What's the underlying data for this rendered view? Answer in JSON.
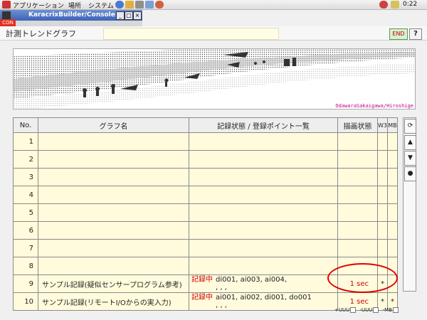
{
  "desktop": {
    "menus": [
      "アプリケーション",
      "場所",
      "システム"
    ],
    "clock": "0:22"
  },
  "window": {
    "title": "KaracrixBuilder/Console",
    "con_tab": "CON"
  },
  "header": {
    "title": "計測トレンドグラフ",
    "end_label": "END",
    "help_label": "?"
  },
  "banner": {
    "caption": "OdawaraSakaigawa/Hiroshige"
  },
  "table": {
    "headers": {
      "no": "No.",
      "name": "グラフ名",
      "points": "記録状態 / 登録ポイント一覧",
      "draw": "描画状態",
      "w3": "W3",
      "mb": "MB"
    },
    "rows": [
      {
        "no": "1",
        "name": "",
        "rec": "",
        "points": "",
        "draw": "",
        "w3": "",
        "mb": ""
      },
      {
        "no": "2",
        "name": "",
        "rec": "",
        "points": "",
        "draw": "",
        "w3": "",
        "mb": ""
      },
      {
        "no": "3",
        "name": "",
        "rec": "",
        "points": "",
        "draw": "",
        "w3": "",
        "mb": ""
      },
      {
        "no": "4",
        "name": "",
        "rec": "",
        "points": "",
        "draw": "",
        "w3": "",
        "mb": ""
      },
      {
        "no": "5",
        "name": "",
        "rec": "",
        "points": "",
        "draw": "",
        "w3": "",
        "mb": ""
      },
      {
        "no": "6",
        "name": "",
        "rec": "",
        "points": "",
        "draw": "",
        "w3": "",
        "mb": ""
      },
      {
        "no": "7",
        "name": "",
        "rec": "",
        "points": "",
        "draw": "",
        "w3": "",
        "mb": ""
      },
      {
        "no": "8",
        "name": "",
        "rec": "",
        "points": "",
        "draw": "",
        "w3": "",
        "mb": ""
      },
      {
        "no": "9",
        "name": "サンプル記録(疑似センサープログラム参考)",
        "rec": "記録中",
        "points": "di001, ai003, ai004,",
        "points2": ", , ,",
        "draw": "1 sec",
        "w3": "*",
        "mb": ""
      },
      {
        "no": "10",
        "name": "サンプル記録(リモートI/Oからの実入力)",
        "rec": "記録中",
        "points": "ai001, ai002, di001, do001",
        "points2": ", , ,",
        "draw": "1 sec",
        "w3": "*",
        "mb": "*"
      }
    ]
  },
  "controls": {
    "refresh_icon": "refresh-icon",
    "up_icon": "triangle-up-icon",
    "down_icon": "triangle-down-icon",
    "dot_icon": "dot-icon"
  },
  "footer": {
    "items": [
      "+UUU",
      "-UUU",
      "-MB"
    ]
  }
}
